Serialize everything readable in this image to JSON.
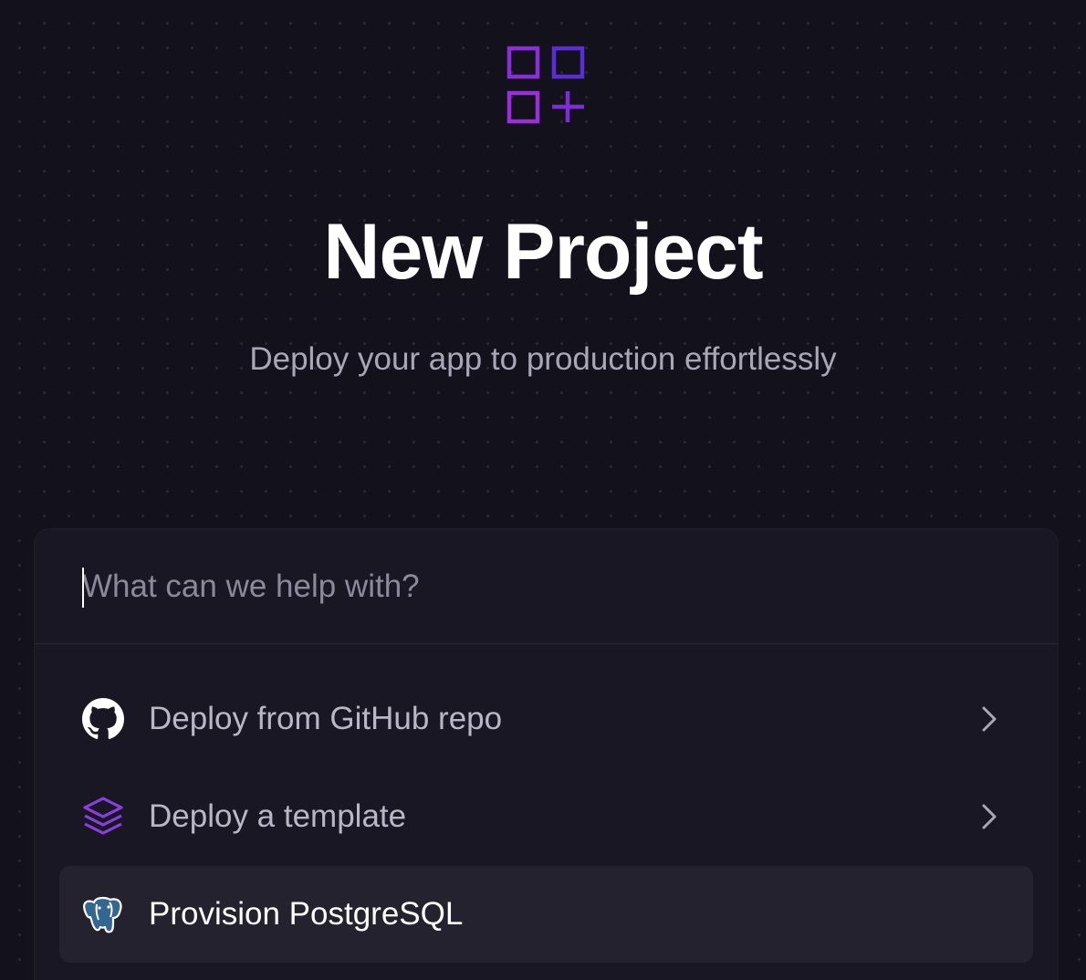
{
  "header": {
    "logo_icon": "grid-plus-icon",
    "title": "New Project",
    "subtitle": "Deploy your app to production effortlessly"
  },
  "search": {
    "placeholder": "What can we help with?",
    "value": ""
  },
  "options": [
    {
      "label": "Deploy from GitHub repo",
      "icon": "github-icon",
      "has_chevron": true,
      "selected": false
    },
    {
      "label": "Deploy a template",
      "icon": "layers-icon",
      "has_chevron": true,
      "selected": false
    },
    {
      "label": "Provision PostgreSQL",
      "icon": "postgresql-icon",
      "has_chevron": false,
      "selected": true
    }
  ],
  "colors": {
    "background": "#13111c",
    "panel": "#191723",
    "selected_row": "#24222f",
    "accent_purple": "#8a2be2",
    "accent_indigo": "#5b2dd6"
  }
}
